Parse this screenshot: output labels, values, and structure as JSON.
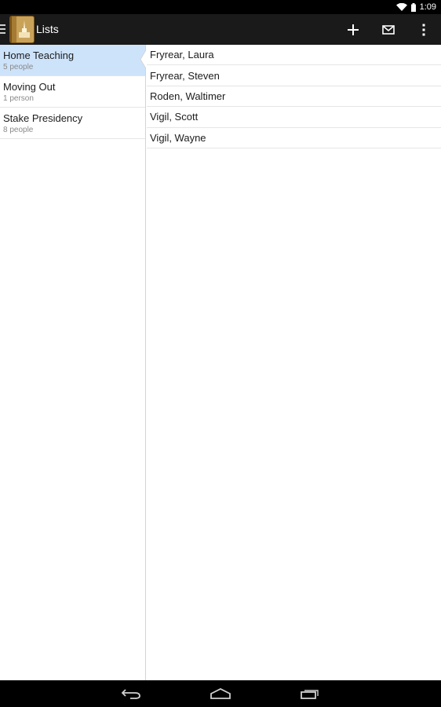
{
  "status_bar": {
    "time": "1:09"
  },
  "action_bar": {
    "title": "Lists",
    "actions": {
      "add": "add-icon",
      "email": "email-icon",
      "overflow": "overflow-menu-icon"
    }
  },
  "lists": [
    {
      "name": "Home Teaching",
      "count": "5 people",
      "selected": true
    },
    {
      "name": "Moving Out",
      "count": "1 person",
      "selected": false
    },
    {
      "name": "Stake Presidency",
      "count": "8 people",
      "selected": false
    }
  ],
  "members": [
    "Fryrear, Laura",
    "Fryrear, Steven",
    "Roden, Waltimer",
    "Vigil, Scott",
    "Vigil, Wayne"
  ],
  "colors": {
    "selected_bg": "#cde3fa",
    "action_bar": "#1a1a1a",
    "divider": "#e5e5e5"
  }
}
